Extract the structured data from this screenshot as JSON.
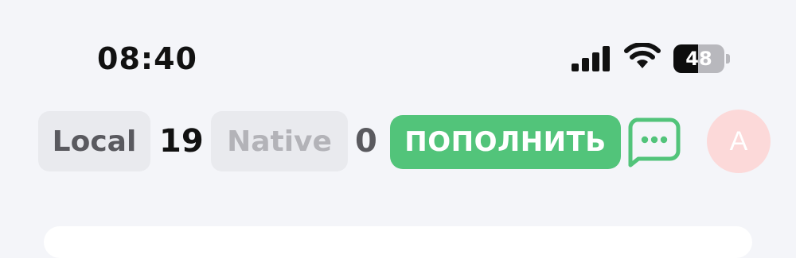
{
  "status_bar": {
    "time": "08:40",
    "battery_percent": "48",
    "battery_level": 0.48
  },
  "balances": {
    "local_label": "Local",
    "local_value": "19",
    "native_label": "Native",
    "native_value": "0"
  },
  "actions": {
    "topup_label": "ПОПОЛНИТЬ",
    "chat_icon": "chat-bubble-icon"
  },
  "user": {
    "avatar_letter": "A"
  },
  "colors": {
    "accent_green": "#52c47a",
    "avatar_bg": "#fcd9d9",
    "background": "#f4f5f9"
  }
}
